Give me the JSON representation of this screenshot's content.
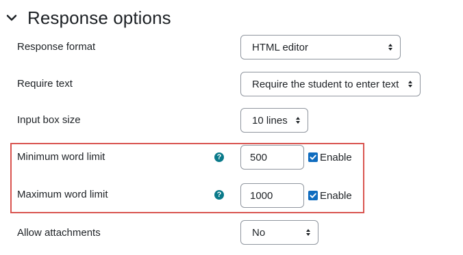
{
  "section": {
    "title": "Response options",
    "expanded": true
  },
  "fields": {
    "response_format": {
      "label": "Response format",
      "value": "HTML editor"
    },
    "require_text": {
      "label": "Require text",
      "value": "Require the student to enter text"
    },
    "input_box_size": {
      "label": "Input box size",
      "value": "10 lines"
    },
    "min_word_limit": {
      "label": "Minimum word limit",
      "value": "500",
      "enable_label": "Enable",
      "enabled": true,
      "help_icon": "question-circle-icon"
    },
    "max_word_limit": {
      "label": "Maximum word limit",
      "value": "1000",
      "enable_label": "Enable",
      "enabled": true,
      "help_icon": "question-circle-icon"
    },
    "allow_attachments": {
      "label": "Allow attachments",
      "value": "No"
    }
  },
  "colors": {
    "accent": "#0f6cbf",
    "help_icon": "#0a7a8a",
    "highlight": "#d9534f",
    "border": "#8f959e"
  }
}
